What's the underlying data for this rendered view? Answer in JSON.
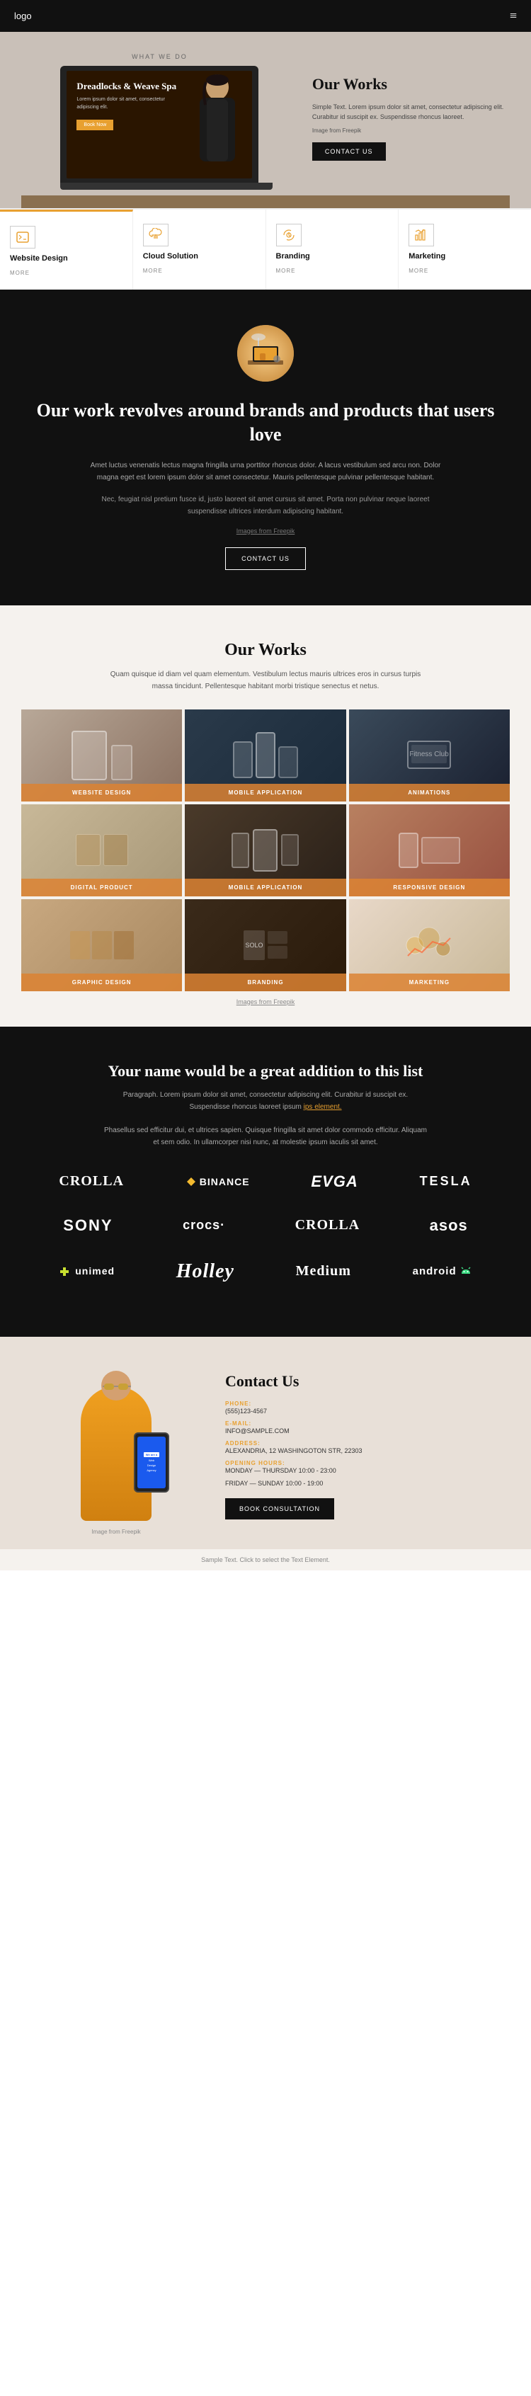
{
  "nav": {
    "logo": "logo",
    "menu_icon": "≡"
  },
  "hero": {
    "label": "WHAT WE DO",
    "title": "Our Works",
    "description": "Simple Text. Lorem ipsum dolor sit amet, consectetur adipiscing elit. Curabitur id suscipit ex. Suspendisse rhoncus laoreet.",
    "image_credit": "Image from Freepik",
    "contact_button": "CONTACT US",
    "laptop": {
      "title": "Dreadlocks & Weave Spa",
      "text": "Lorem ipsum dolor sit amet, consectetur adipiscing elit.",
      "button": "Book Now"
    }
  },
  "services": [
    {
      "id": "website-design",
      "icon": "code",
      "name": "Website Design",
      "more": "MORE",
      "highlight": true
    },
    {
      "id": "cloud-solution",
      "icon": "cloud",
      "name": "Cloud Solution",
      "more": "MORE",
      "highlight": false
    },
    {
      "id": "branding",
      "icon": "megaphone",
      "name": "Branding",
      "more": "MORE",
      "highlight": false
    },
    {
      "id": "marketing",
      "icon": "chart",
      "name": "Marketing",
      "more": "MORE",
      "highlight": false
    }
  ],
  "brands_section": {
    "title": "Our work revolves around brands\nand products that users love",
    "desc1": "Amet luctus venenatis lectus magna fringilla urna porttitor rhoncus dolor. A lacus vestibulum sed arcu non. Dolor magna eget est lorem ipsum dolor sit amet consectetur. Mauris pellentesque pulvinar pellentesque habitant.",
    "desc2": "Nec, feugiat nisl pretium fusce id, justo laoreet sit amet cursus sit amet. Porta non pulvinar neque laoreet suspendisse ultrices interdum adipiscing habitant.",
    "image_credit": "Images from Freepik",
    "contact_button": "CONTACT US"
  },
  "portfolio": {
    "title": "Our Works",
    "description": "Quam quisque id diam vel quam elementum. Vestibulum lectus mauris ultrices eros in cursus turpis massa tincidunt. Pellentesque habitant morbi tristique senectus et netus.",
    "image_credit": "Images from Freepik",
    "items": [
      {
        "id": "website-design",
        "label": "WEBSITE DESIGN",
        "bg": "port-bg-1"
      },
      {
        "id": "mobile-app-1",
        "label": "MOBILE APPLICATION",
        "bg": "port-bg-2"
      },
      {
        "id": "animations",
        "label": "ANIMATIONS",
        "bg": "port-bg-3"
      },
      {
        "id": "digital-product",
        "label": "DIGITAL PRODUCT",
        "bg": "port-bg-4"
      },
      {
        "id": "mobile-app-2",
        "label": "MOBILE APPLICATION",
        "bg": "port-bg-5"
      },
      {
        "id": "responsive-design",
        "label": "RESPONSIVE DESIGN",
        "bg": "port-bg-6"
      },
      {
        "id": "graphic-design",
        "label": "GRAPHIC DESIGN",
        "bg": "port-bg-7"
      },
      {
        "id": "branding",
        "label": "BRANDING",
        "bg": "port-bg-8"
      },
      {
        "id": "marketing",
        "label": "MARKETING",
        "bg": "port-bg-9"
      }
    ]
  },
  "clients": {
    "title": "Your name would be a great\naddition to this list",
    "description": "Paragraph. Lorem ipsum dolor sit amet, consectetur adipiscing elit. Curabitur id suscipit ex. Suspendisse rhoncus laoreet ipsum ",
    "link_text": "ips element.",
    "extra_desc": "Phasellus sed efficitur dui, et ultrices sapien. Quisque fringilla sit amet dolor commodo efficitur. Aliquam et sem odio. In ullamcorper nisi nunc, at molestie ipsum iaculis sit amet.",
    "logos": [
      {
        "id": "crolla-1",
        "name": "CROLLA",
        "style": "normal"
      },
      {
        "id": "binance",
        "name": "◆BINANCE",
        "style": "normal"
      },
      {
        "id": "evga",
        "name": "EVGA",
        "style": "italic"
      },
      {
        "id": "tesla",
        "name": "TESLA",
        "style": "normal"
      },
      {
        "id": "sony",
        "name": "SONY",
        "style": "bold"
      },
      {
        "id": "crocs",
        "name": "crocs·",
        "style": "normal"
      },
      {
        "id": "crolla-2",
        "name": "CROLLA",
        "style": "normal"
      },
      {
        "id": "asos",
        "name": "asos",
        "style": "normal"
      },
      {
        "id": "unimed",
        "name": "unimed",
        "style": "normal"
      },
      {
        "id": "holley",
        "name": "Holley",
        "style": "bold"
      },
      {
        "id": "medium",
        "name": "Medium",
        "style": "normal"
      },
      {
        "id": "android",
        "name": "android",
        "style": "normal"
      }
    ]
  },
  "contact": {
    "title": "Contact Us",
    "phone_label": "PHONE:",
    "phone_value": "(555)123-4567",
    "email_label": "E-MAIL:",
    "email_value": "INFO@SAMPLE.COM",
    "address_label": "ADDRESS:",
    "address_value": "ALEXANDRIA, 12 WASHINGOTON STR, 22303",
    "hours_label": "OPENING HOURS:",
    "hours_weekday": "MONDAY — THURSDAY 10:00 - 23:00",
    "hours_weekend": "FRIDAY — SUNDAY 10:00 - 19:00",
    "image_credit": "Image from Freepik",
    "book_button": "BOOK CONSULTATION",
    "phone_screen": {
      "tag": "We are a",
      "line1": "Web",
      "line2": "Design",
      "line3": "Agency"
    }
  },
  "footer": {
    "text": "Sample Text. Click to select the Text Element."
  },
  "colors": {
    "accent": "#e8a030",
    "dark": "#111111",
    "light_bg": "#f5f2ee",
    "hero_bg": "#c9c0b8"
  }
}
